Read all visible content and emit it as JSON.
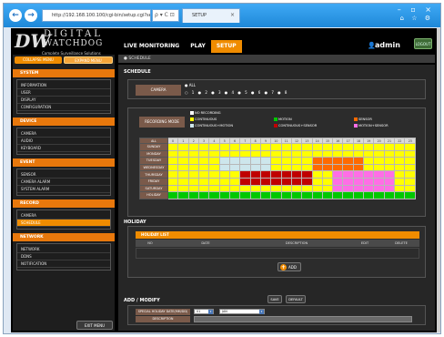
{
  "browser": {
    "back": "←",
    "forward": "→",
    "url": "http://192.168.100.100/cgi-bin/setup.cgi?section=schedule",
    "addr_tools": "ρ ▾ C ⊡",
    "tab_title": "SETUP",
    "tab_close": "×",
    "window_buttons": "– ▫ ×",
    "toolbar_icons": "⌂ ☆ ⚙"
  },
  "app": {
    "logo_mark": "DW",
    "logo_line1": "DIGITAL",
    "logo_line2": "WATCHDOG",
    "logo_tagline": "Complete Surveillance Solutions",
    "nav": [
      "LIVE MONITORING",
      "PLAY",
      "SETUP"
    ],
    "active_nav": "SETUP",
    "user": "admin",
    "user_icon": "👤",
    "logout": "LOGOUT",
    "breadcrumb": "● SCHEDULE"
  },
  "sidebar": {
    "tabs": [
      "COLLAPSE MENU",
      "EXPAND MENU"
    ],
    "sections": [
      {
        "title": "SYSTEM",
        "items": [
          "INFORMATION",
          "USER",
          "DISPLAY",
          "CONFIGURATION"
        ]
      },
      {
        "title": "DEVICE",
        "items": [
          "CAMERA",
          "AUDIO",
          "KEYBOARD"
        ]
      },
      {
        "title": "EVENT",
        "items": [
          "SENSOR",
          "CAMERA ALARM",
          "SYSTEM ALARM"
        ]
      },
      {
        "title": "RECORD",
        "items": [
          "CAMERA",
          "SCHEDULE"
        ]
      },
      {
        "title": "NETWORK",
        "items": [
          "NETWORK",
          "DDNS",
          "NOTIFICATION"
        ]
      }
    ],
    "active_item": "SCHEDULE",
    "exit_menu": "EXIT MENU"
  },
  "schedule": {
    "heading": "SCHEDULE",
    "camera_label": "CAMERA",
    "camera_all": "ALL",
    "camera_options": [
      "1",
      "2",
      "3",
      "4",
      "5",
      "6",
      "7",
      "8"
    ],
    "recording_mode_label": "RECORDING MODE",
    "modes": [
      {
        "label": "NO RECORDING",
        "color": "#ffffff"
      },
      {
        "label": "CONTINUOUS",
        "color": "#ffff00"
      },
      {
        "label": "CONTINUOUS+MOTION",
        "color": "#cde6ec"
      },
      {
        "label": "MOTION",
        "color": "#00c800"
      },
      {
        "label": "CONTINUOUS+SENSOR",
        "color": "#c00000"
      },
      {
        "label": "SENSOR",
        "color": "#ff6a00"
      },
      {
        "label": "MOTION+SENSOR",
        "color": "#ff6ee6"
      }
    ],
    "grid_header_label": "ALL",
    "hours": [
      "0",
      "1",
      "2",
      "3",
      "4",
      "5",
      "6",
      "7",
      "8",
      "9",
      "10",
      "11",
      "12",
      "13",
      "14",
      "15",
      "16",
      "17",
      "18",
      "19",
      "20",
      "21",
      "22",
      "23"
    ],
    "days": [
      "SUNDAY",
      "MONDAY",
      "TUESDAY",
      "WEDNESDAY",
      "THURSDAY",
      "FRIDAY",
      "SATURDAY",
      "HOLIDAY"
    ]
  },
  "holiday": {
    "heading": "HOLIDAY",
    "list_title": "HOLIDAY LIST",
    "columns": [
      "NO",
      "DATE",
      "DESCRIPTION",
      "EDIT",
      "DELETE"
    ],
    "add_label": "ADD"
  },
  "modify": {
    "heading": "ADD / MODIFY",
    "date_label": "SPECIAL HOLIDAY DATE(MM/DD)",
    "month": "01",
    "day": "JAN",
    "description_label": "DESCRIPTION",
    "description_value": ""
  },
  "buttons": {
    "save": "SAVE",
    "default": "DEFAULT"
  }
}
